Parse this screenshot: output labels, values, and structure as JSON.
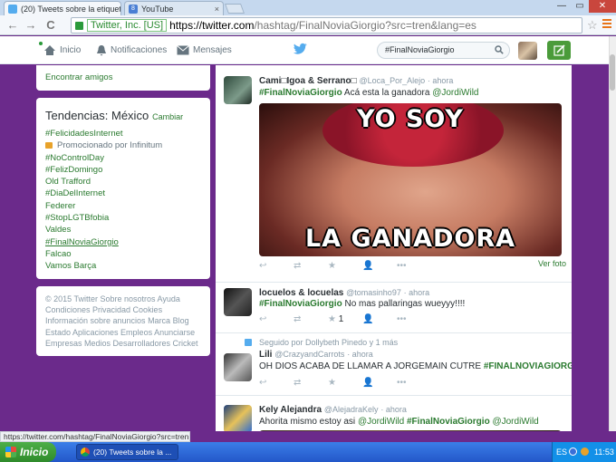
{
  "browser": {
    "tabs": [
      {
        "title": "(20) Tweets sobre la etiquet",
        "close": "×"
      },
      {
        "title": "YouTube",
        "close": "×"
      }
    ],
    "yt_favicon": "8",
    "window_controls": [
      "—",
      "▭",
      "✕"
    ],
    "nav": {
      "back": "←",
      "forward": "→",
      "reload": "C"
    },
    "ev_label": "Twitter, Inc. [US]",
    "url_host": "https://twitter.com",
    "url_path": "/hashtag/FinalNoviaGiorgio?src=tren&lang=es",
    "star": "☆",
    "status_url": "https://twitter.com/hashtag/FinalNoviaGiorgio?src=tren"
  },
  "twitter_nav": {
    "home": "Inicio",
    "notifications": "Notificaciones",
    "messages": "Mensajes",
    "search_value": "#FinalNoviaGiorgio"
  },
  "sidebar": {
    "find_friends": "Encontrar amigos",
    "trends_title": "Tendencias: México",
    "trends_change": "Cambiar",
    "promoted_trend": "#FelicidadesInternet",
    "promoted_by": "Promocionado por Infinitum",
    "trends": [
      "#NoControlDay",
      "#FelizDomingo",
      "Old Trafford",
      "#DiaDelInternet",
      "Federer",
      "#StopLGTBfobia",
      "Valdes",
      "#FinalNoviaGiorgio",
      "Falcao",
      "Vamos Barça"
    ]
  },
  "footer_lines": [
    "© 2015 Twitter  Sobre nosotros  Ayuda",
    "Condiciones  Privacidad  Cookies",
    "Información sobre anuncios  Marca  Blog",
    "Estado  Aplicaciones  Empleos  Anunciarse",
    "Empresas  Medios  Desarrolladores  Cricket"
  ],
  "tweets": [
    {
      "name": "Cami□Igoa & Serrano□",
      "handle": "@Loca_Por_Alejo",
      "time": "· ahora",
      "text_hashtag": "#FinalNoviaGiorgio",
      "text_body": " Acá esta la ganadora ",
      "text_mention": "@JordiWild",
      "meme_top": "YO SOY",
      "meme_bottom": "LA GANADORA",
      "view_photo": "Ver foto",
      "actions": [
        "↩",
        "⇄",
        "★",
        "👤",
        "•••"
      ]
    },
    {
      "name": "locuelos & locuelas",
      "handle": "@tomasinho97",
      "time": "· ahora",
      "text_hashtag": "#FinalNoviaGiorgio",
      "text_body": " No mas pallaringas wueyyy!!!!",
      "favorite_count": "1",
      "actions": [
        "↩",
        "⇄",
        "★",
        "👤",
        "•••"
      ]
    },
    {
      "followed_note": "Seguido por Dollybeth Pinedo y 1 más",
      "name": "Lili",
      "handle": "@CrazyandCarrots",
      "time": "· ahora",
      "text_body": "OH DIOS ACABA DE LLAMAR A JORGEMAIN CUTRE ",
      "text_hashtag": "#FINALNOVIAGIORGIO",
      "actions": [
        "↩",
        "⇄",
        "★",
        "👤",
        "•••"
      ]
    },
    {
      "name": "Kely Alejandra",
      "handle": "@AlejadraKely",
      "time": "· ahora",
      "text_body": "Ahorita mismo estoy asi ",
      "text_mention": "@JordiWild",
      "text_hashtag": "#FinalNoviaGiorgio",
      "text_mention2": "@JordiWild"
    }
  ],
  "taskbar": {
    "start": "Inicio",
    "item": "(20) Tweets sobre la ...",
    "lang": "ES",
    "time": "11:53"
  },
  "colors": {
    "accent_green": "#2a7a2f",
    "page_bg": "#6b2a8b",
    "taskbar": "#2357c9"
  }
}
